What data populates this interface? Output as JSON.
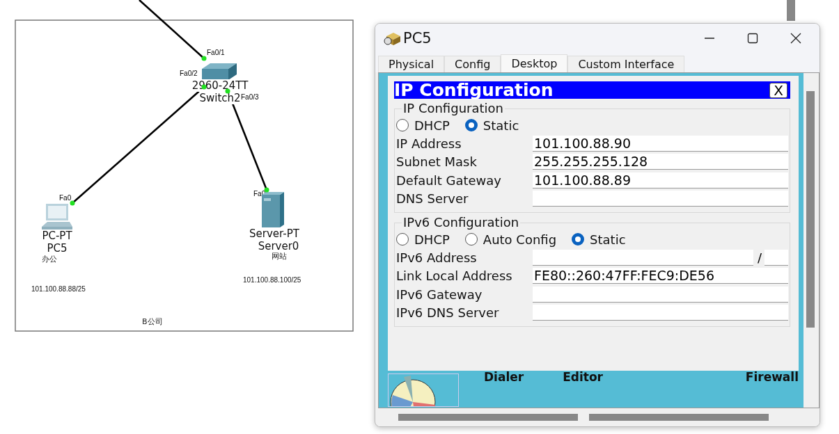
{
  "topology": {
    "area_label": "B公司",
    "devices": [
      {
        "kind": "switch",
        "model": "2960-24TT",
        "name": "Switch2"
      },
      {
        "kind": "pc",
        "model": "PC-PT",
        "name": "PC5",
        "note": "办公",
        "address": "101.100.88.88/25"
      },
      {
        "kind": "server",
        "model": "Server-PT",
        "name": "Server0",
        "note": "网站",
        "address": "101.100.88.100/25"
      }
    ],
    "links": [
      {
        "port_a": "Fa0/1",
        "up": true
      },
      {
        "port_a": "Fa0/2",
        "port_b": "Fa0",
        "up": true
      },
      {
        "port_a": "Fa0/3",
        "port_b": "Fa0",
        "up": true
      }
    ]
  },
  "window": {
    "title": "PC5",
    "tabs": [
      {
        "label": "Physical",
        "selected": false
      },
      {
        "label": "Config",
        "selected": false
      },
      {
        "label": "Desktop",
        "selected": true
      },
      {
        "label": "Custom Interface",
        "selected": false
      }
    ],
    "panel": {
      "title": "IP Configuration",
      "close": "X",
      "ipv4": {
        "legend": "IP Configuration",
        "modes": [
          {
            "label": "DHCP",
            "selected": false
          },
          {
            "label": "Static",
            "selected": true
          }
        ],
        "fields": [
          {
            "label": "IP Address",
            "value": "101.100.88.90"
          },
          {
            "label": "Subnet Mask",
            "value": "255.255.255.128"
          },
          {
            "label": "Default Gateway",
            "value": "101.100.88.89"
          },
          {
            "label": "DNS Server"
          }
        ]
      },
      "ipv6": {
        "legend": "IPv6 Configuration",
        "modes": [
          {
            "label": "DHCP",
            "selected": false
          },
          {
            "label": "Auto Config",
            "selected": false
          },
          {
            "label": "Static",
            "selected": true
          }
        ],
        "fields": [
          {
            "label": "IPv6 Address",
            "kind": "prefix",
            "separator": "/"
          },
          {
            "label": "Link Local Address",
            "value": "FE80::260:47FF:FEC9:DE56"
          },
          {
            "label": "IPv6 Gateway"
          },
          {
            "label": "IPv6 DNS Server"
          }
        ]
      }
    },
    "apps": [
      "Dialer",
      "Editor",
      "Firewall"
    ]
  }
}
